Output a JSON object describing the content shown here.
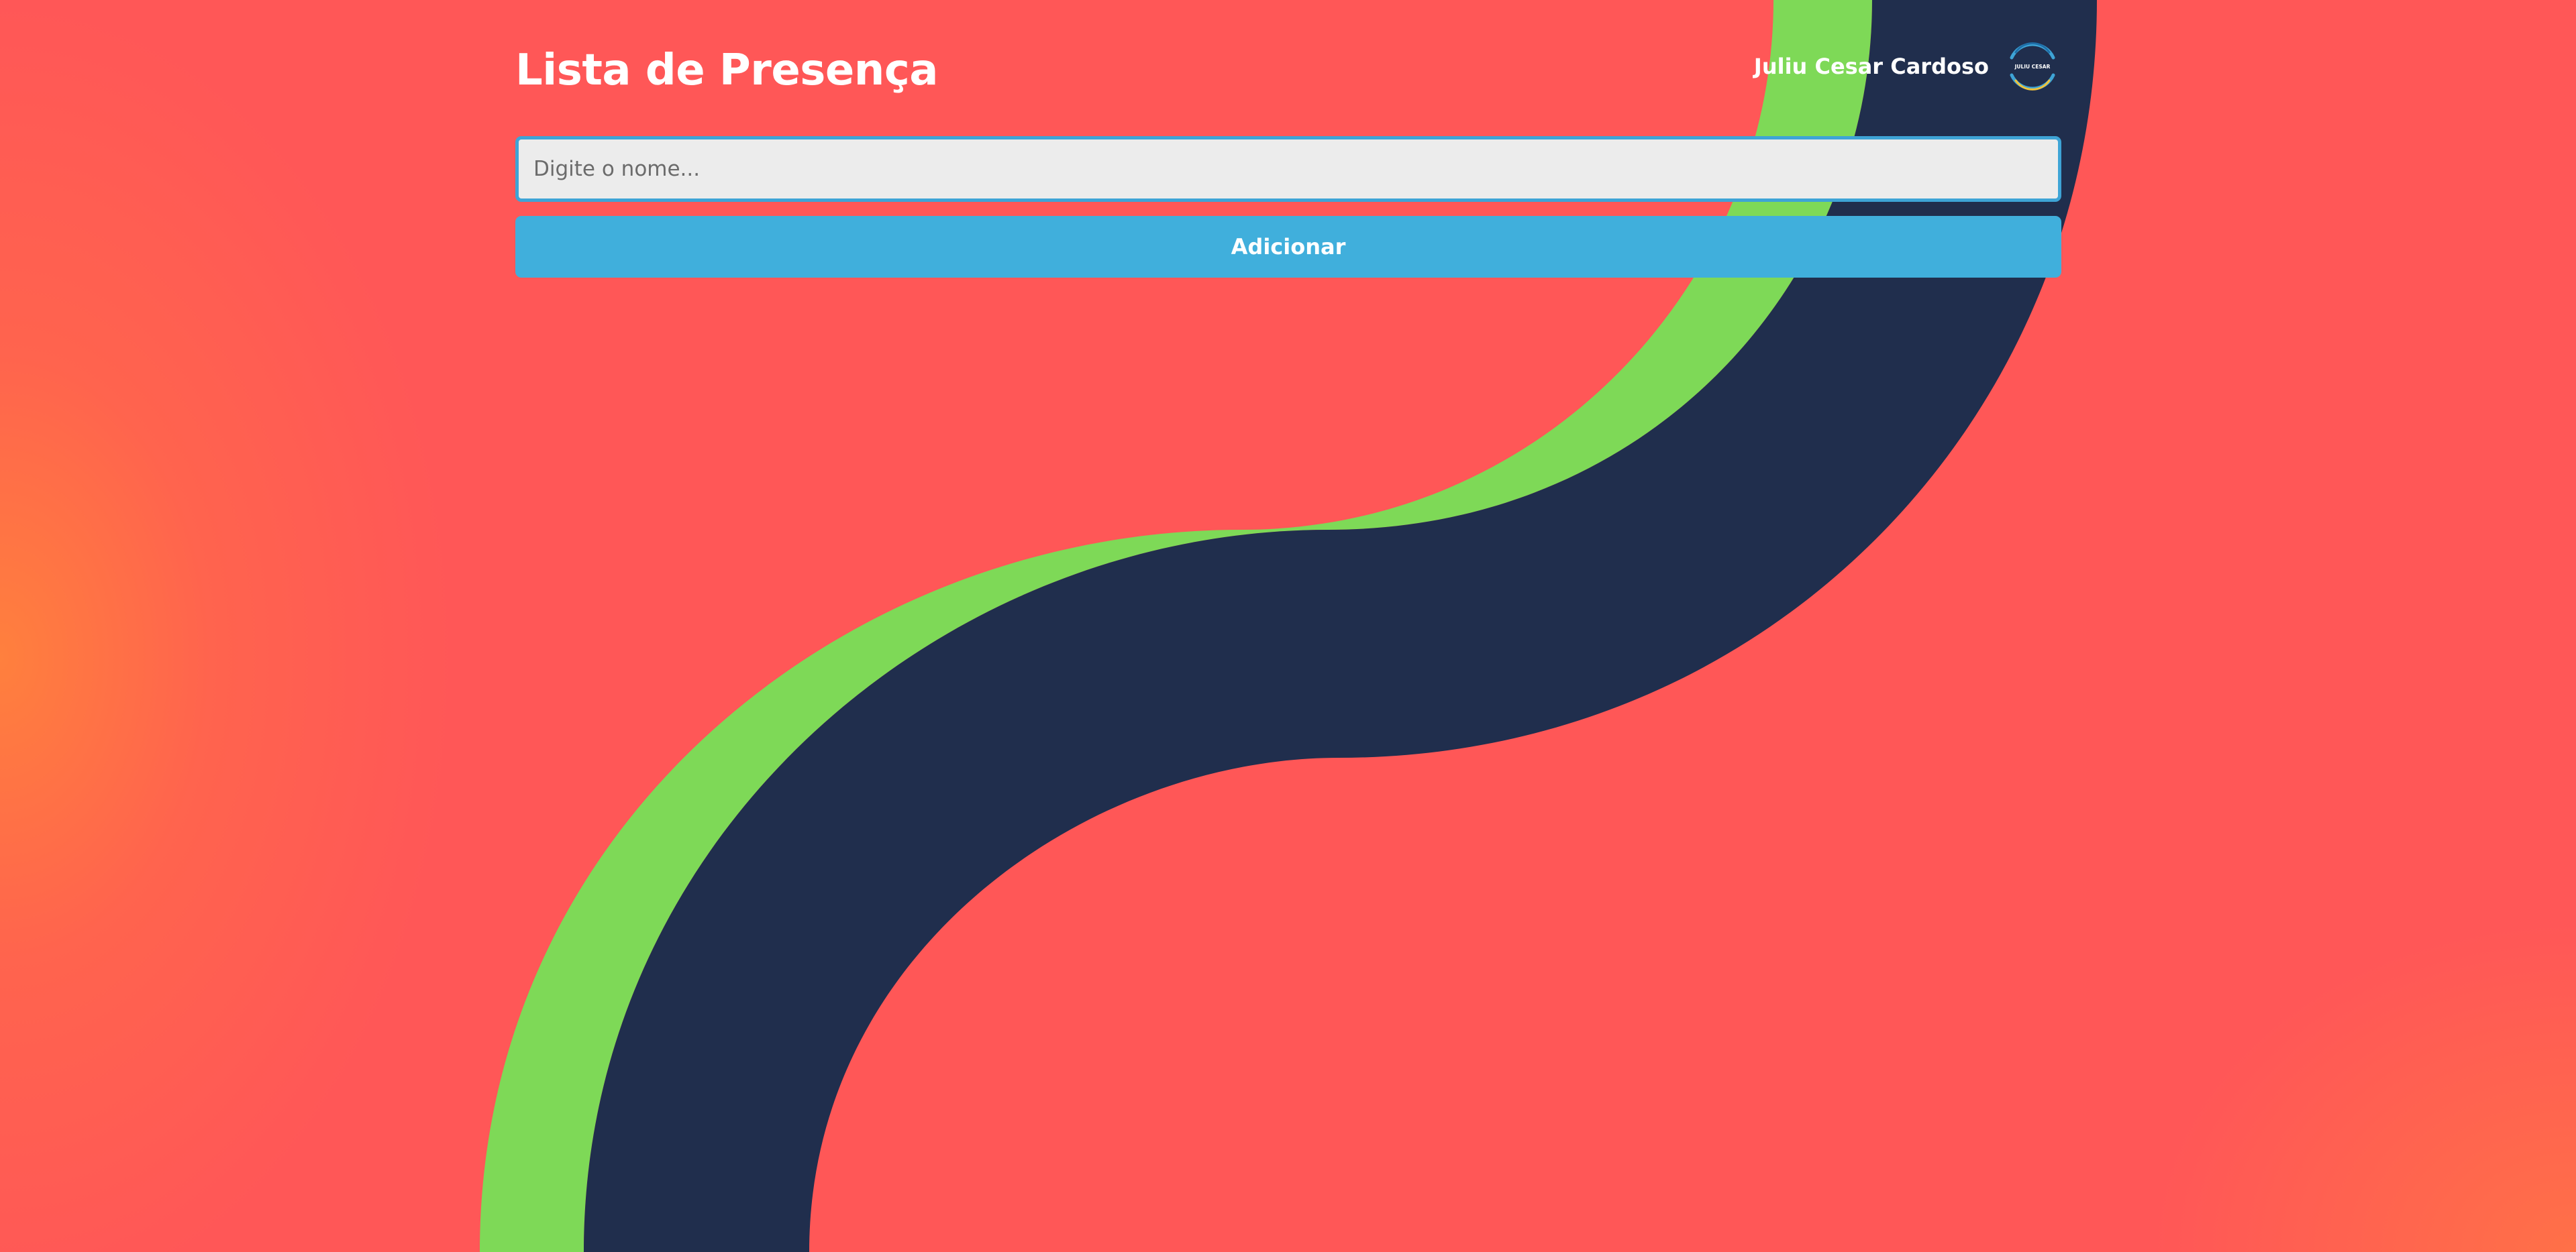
{
  "header": {
    "title": "Lista de Presença",
    "user_name": "Juliu Cesar Cardoso",
    "avatar_text": "JULIU CESAR",
    "avatar_icon": "circular-logo-icon"
  },
  "form": {
    "name_placeholder": "Digite o nome...",
    "name_value": "",
    "add_label": "Adicionar"
  },
  "colors": {
    "background": "#ff5757",
    "background_glow": "#ff8a3d",
    "wave_green": "#7ed957",
    "wave_navy": "#202e4d",
    "accent": "#40afdc",
    "input_border": "#3ea4d6",
    "input_bg": "#ececec",
    "text_light": "#ffffff"
  }
}
